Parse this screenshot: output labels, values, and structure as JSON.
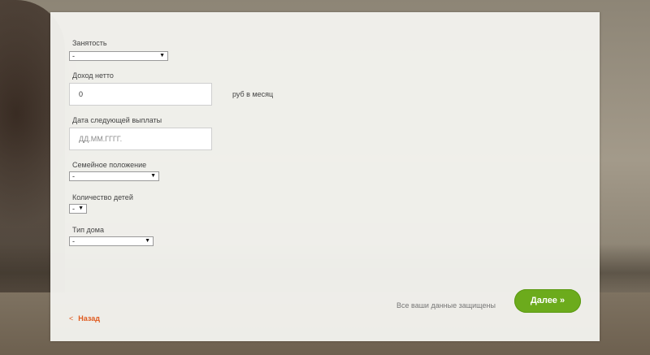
{
  "form": {
    "employment": {
      "label": "Занятость",
      "value": "-"
    },
    "net_income": {
      "label": "Доход нетто",
      "value": "0",
      "unit": "руб в месяц"
    },
    "next_payment_date": {
      "label": "Дата следующей выплаты",
      "placeholder": "ДД.ММ.ГГГГ."
    },
    "marital_status": {
      "label": "Семейное положение",
      "value": "-"
    },
    "children_count": {
      "label": "Количество детей",
      "value": "-"
    },
    "home_type": {
      "label": "Тип дома",
      "value": "-"
    }
  },
  "footer": {
    "back_chevron": "<",
    "back_label": "Назад",
    "secure_text": "Все ваши данные защищены",
    "next_label": "Далее »"
  },
  "icons": {
    "dropdown": "chevron-down-icon",
    "back": "chevron-left-icon"
  },
  "colors": {
    "accent": "#6cab1c",
    "link": "#e05a1e"
  }
}
